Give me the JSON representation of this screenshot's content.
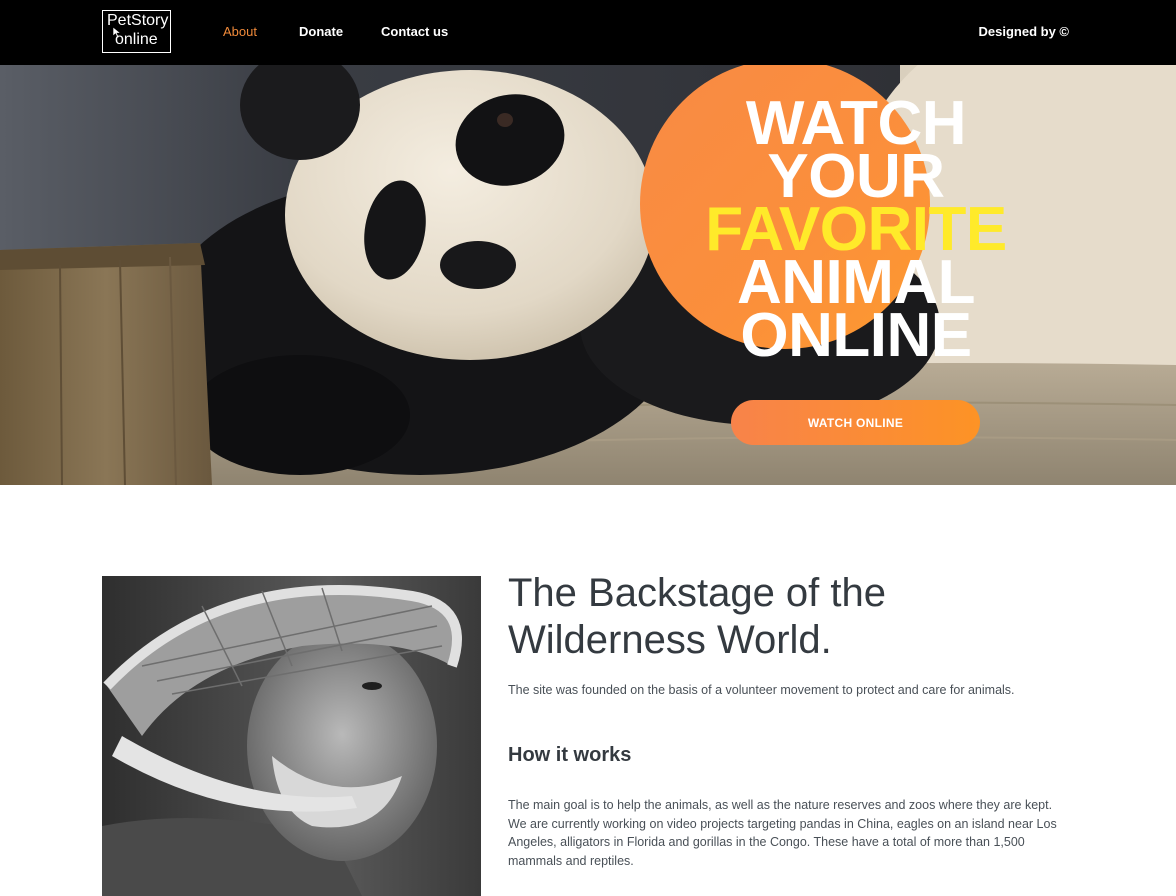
{
  "nav": {
    "logo_line1": "PetStory",
    "logo_line2": "online",
    "links": [
      {
        "label": "About",
        "active": true
      },
      {
        "label": "Donate",
        "active": false
      },
      {
        "label": "Contact us",
        "active": false
      }
    ],
    "credit": "Designed by ©"
  },
  "hero": {
    "headline_lines": [
      "WATCH",
      "YOUR",
      "FAVORITE",
      "ANIMAL",
      "ONLINE"
    ],
    "button_label": "WATCH ONLINE"
  },
  "about": {
    "title": "The Backstage of the Wilderness World.",
    "intro": "The site was founded on the basis of a volunteer movement to protect and care for animals.",
    "subhead": "How it works",
    "body": "The main goal is to help the animals, as well as the nature reserves and zoos where they are kept. We are currently working on video projects targeting pandas in China, eagles on an island near Los Angeles, alligators in Florida and gorillas in the Congo. These have a total of more than 1,500 mammals and reptiles."
  },
  "colors": {
    "nav_bg": "#000000",
    "accent": "#f08a3a",
    "highlight": "#ffea2a",
    "button_gradient_start": "#f8834a",
    "button_gradient_end": "#fd9325"
  }
}
